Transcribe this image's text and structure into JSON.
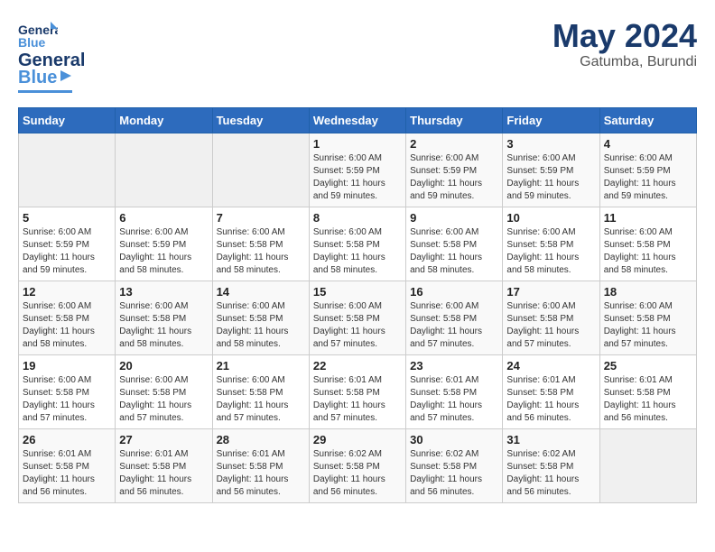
{
  "logo": {
    "line1": "General",
    "line2": "Blue"
  },
  "title": {
    "month_year": "May 2024",
    "location": "Gatumba, Burundi"
  },
  "days_of_week": [
    "Sunday",
    "Monday",
    "Tuesday",
    "Wednesday",
    "Thursday",
    "Friday",
    "Saturday"
  ],
  "weeks": [
    [
      {
        "day": "",
        "info": ""
      },
      {
        "day": "",
        "info": ""
      },
      {
        "day": "",
        "info": ""
      },
      {
        "day": "1",
        "info": "Sunrise: 6:00 AM\nSunset: 5:59 PM\nDaylight: 11 hours\nand 59 minutes."
      },
      {
        "day": "2",
        "info": "Sunrise: 6:00 AM\nSunset: 5:59 PM\nDaylight: 11 hours\nand 59 minutes."
      },
      {
        "day": "3",
        "info": "Sunrise: 6:00 AM\nSunset: 5:59 PM\nDaylight: 11 hours\nand 59 minutes."
      },
      {
        "day": "4",
        "info": "Sunrise: 6:00 AM\nSunset: 5:59 PM\nDaylight: 11 hours\nand 59 minutes."
      }
    ],
    [
      {
        "day": "5",
        "info": "Sunrise: 6:00 AM\nSunset: 5:59 PM\nDaylight: 11 hours\nand 59 minutes."
      },
      {
        "day": "6",
        "info": "Sunrise: 6:00 AM\nSunset: 5:59 PM\nDaylight: 11 hours\nand 58 minutes."
      },
      {
        "day": "7",
        "info": "Sunrise: 6:00 AM\nSunset: 5:58 PM\nDaylight: 11 hours\nand 58 minutes."
      },
      {
        "day": "8",
        "info": "Sunrise: 6:00 AM\nSunset: 5:58 PM\nDaylight: 11 hours\nand 58 minutes."
      },
      {
        "day": "9",
        "info": "Sunrise: 6:00 AM\nSunset: 5:58 PM\nDaylight: 11 hours\nand 58 minutes."
      },
      {
        "day": "10",
        "info": "Sunrise: 6:00 AM\nSunset: 5:58 PM\nDaylight: 11 hours\nand 58 minutes."
      },
      {
        "day": "11",
        "info": "Sunrise: 6:00 AM\nSunset: 5:58 PM\nDaylight: 11 hours\nand 58 minutes."
      }
    ],
    [
      {
        "day": "12",
        "info": "Sunrise: 6:00 AM\nSunset: 5:58 PM\nDaylight: 11 hours\nand 58 minutes."
      },
      {
        "day": "13",
        "info": "Sunrise: 6:00 AM\nSunset: 5:58 PM\nDaylight: 11 hours\nand 58 minutes."
      },
      {
        "day": "14",
        "info": "Sunrise: 6:00 AM\nSunset: 5:58 PM\nDaylight: 11 hours\nand 58 minutes."
      },
      {
        "day": "15",
        "info": "Sunrise: 6:00 AM\nSunset: 5:58 PM\nDaylight: 11 hours\nand 57 minutes."
      },
      {
        "day": "16",
        "info": "Sunrise: 6:00 AM\nSunset: 5:58 PM\nDaylight: 11 hours\nand 57 minutes."
      },
      {
        "day": "17",
        "info": "Sunrise: 6:00 AM\nSunset: 5:58 PM\nDaylight: 11 hours\nand 57 minutes."
      },
      {
        "day": "18",
        "info": "Sunrise: 6:00 AM\nSunset: 5:58 PM\nDaylight: 11 hours\nand 57 minutes."
      }
    ],
    [
      {
        "day": "19",
        "info": "Sunrise: 6:00 AM\nSunset: 5:58 PM\nDaylight: 11 hours\nand 57 minutes."
      },
      {
        "day": "20",
        "info": "Sunrise: 6:00 AM\nSunset: 5:58 PM\nDaylight: 11 hours\nand 57 minutes."
      },
      {
        "day": "21",
        "info": "Sunrise: 6:00 AM\nSunset: 5:58 PM\nDaylight: 11 hours\nand 57 minutes."
      },
      {
        "day": "22",
        "info": "Sunrise: 6:01 AM\nSunset: 5:58 PM\nDaylight: 11 hours\nand 57 minutes."
      },
      {
        "day": "23",
        "info": "Sunrise: 6:01 AM\nSunset: 5:58 PM\nDaylight: 11 hours\nand 57 minutes."
      },
      {
        "day": "24",
        "info": "Sunrise: 6:01 AM\nSunset: 5:58 PM\nDaylight: 11 hours\nand 56 minutes."
      },
      {
        "day": "25",
        "info": "Sunrise: 6:01 AM\nSunset: 5:58 PM\nDaylight: 11 hours\nand 56 minutes."
      }
    ],
    [
      {
        "day": "26",
        "info": "Sunrise: 6:01 AM\nSunset: 5:58 PM\nDaylight: 11 hours\nand 56 minutes."
      },
      {
        "day": "27",
        "info": "Sunrise: 6:01 AM\nSunset: 5:58 PM\nDaylight: 11 hours\nand 56 minutes."
      },
      {
        "day": "28",
        "info": "Sunrise: 6:01 AM\nSunset: 5:58 PM\nDaylight: 11 hours\nand 56 minutes."
      },
      {
        "day": "29",
        "info": "Sunrise: 6:02 AM\nSunset: 5:58 PM\nDaylight: 11 hours\nand 56 minutes."
      },
      {
        "day": "30",
        "info": "Sunrise: 6:02 AM\nSunset: 5:58 PM\nDaylight: 11 hours\nand 56 minutes."
      },
      {
        "day": "31",
        "info": "Sunrise: 6:02 AM\nSunset: 5:58 PM\nDaylight: 11 hours\nand 56 minutes."
      },
      {
        "day": "",
        "info": ""
      }
    ]
  ]
}
